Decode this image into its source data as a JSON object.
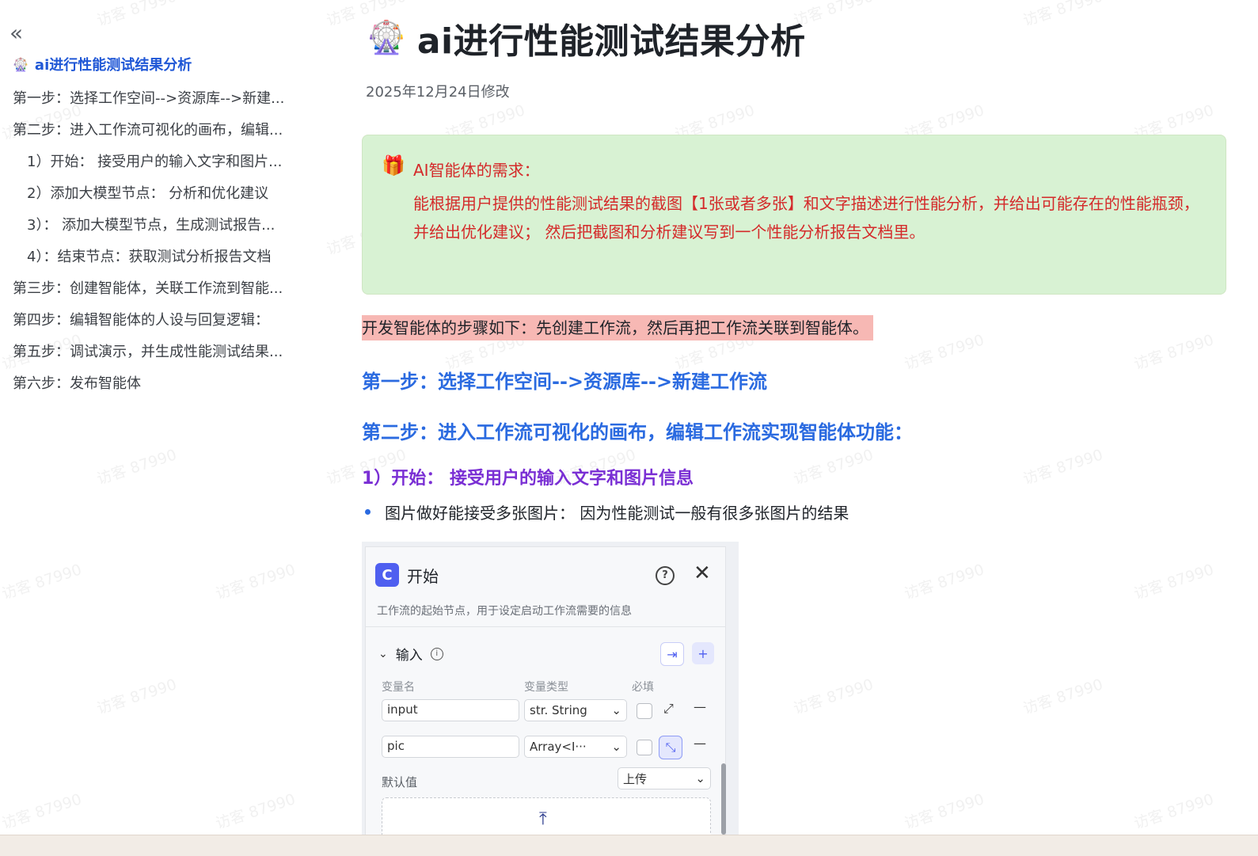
{
  "watermark": "访客 87990",
  "sidebar": {
    "collapse_icon": "double-chevron-left-icon",
    "title_emoji": "🎡",
    "title": "ai进行性能测试结果分析",
    "items": [
      "第一步：选择工作空间-->资源库-->新建...",
      "第二步：进入工作流可视化的画布，编辑...",
      "1）开始： 接受用户的输入文字和图片...",
      "2）添加大模型节点： 分析和优化建议",
      "3）： 添加大模型节点，生成测试报告...",
      "4）：结束节点：获取测试分析报告文档",
      "第三步：创建智能体，关联工作流到智能...",
      "第四步：编辑智能体的人设与回复逻辑：",
      "第五步：调试演示，并生成性能测试结果...",
      "第六步：发布智能体"
    ]
  },
  "main": {
    "title_emoji": "🎡",
    "title": "ai进行性能测试结果分析",
    "modified": "2025年12月24日修改",
    "callout": {
      "icon": "🎁",
      "title": "AI智能体的需求：",
      "body": "能根据用户提供的性能测试结果的截图【1张或者多张】和文字描述进行性能分析，并给出可能存在的性能瓶颈，并给出优化建议； 然后把截图和分析建议写到一个性能分析报告文档里。",
      "colors": {
        "background": "#d8f2d3",
        "text": "#d42a2a"
      }
    },
    "highlight": "开发智能体的步骤如下：先创建工作流，然后再把工作流关联到智能体。",
    "step1": "第一步：选择工作空间-->资源库-->新建工作流",
    "step2": "第二步：进入工作流可视化的画布，编辑工作流实现智能体功能：",
    "sub1": "1）开始： 接受用户的输入文字和图片信息",
    "bullet1": "图片做好能接受多张图片： 因为性能测试一般有很多张图片的结果",
    "accent_colors": {
      "heading": "#2a6ae0",
      "subheading": "#7a2fd4",
      "highlight": "#f7b8b4"
    }
  },
  "panel": {
    "logo": "C",
    "title": "开始",
    "help_icon": "?",
    "close_icon": "✕",
    "description": "工作流的起始节点，用于设定启动工作流需要的信息",
    "section": "输入",
    "col_name": "变量名",
    "col_type": "变量类型",
    "col_required": "必填",
    "rows": [
      {
        "name": "input",
        "type": "str. String"
      },
      {
        "name": "pic",
        "type": "Array<I···"
      }
    ],
    "default_label": "默认值",
    "default_select": "上传"
  }
}
